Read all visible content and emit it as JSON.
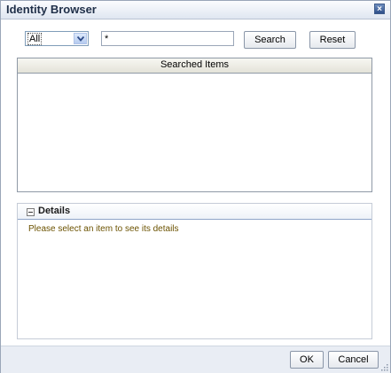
{
  "dialog": {
    "title": "Identity Browser",
    "close_icon": "close-icon"
  },
  "search": {
    "scope_selected": "All",
    "query_value": "*",
    "search_label": "Search",
    "reset_label": "Reset"
  },
  "results": {
    "header": "Searched Items",
    "items": []
  },
  "details": {
    "title": "Details",
    "message": "Please select an item to see its details",
    "toggle_icon": "collapse-icon"
  },
  "footer": {
    "ok_label": "OK",
    "cancel_label": "Cancel"
  },
  "colors": {
    "title_text": "#1f2f48",
    "details_message_text": "#6b5200",
    "footer_bg": "#e9edf4"
  }
}
